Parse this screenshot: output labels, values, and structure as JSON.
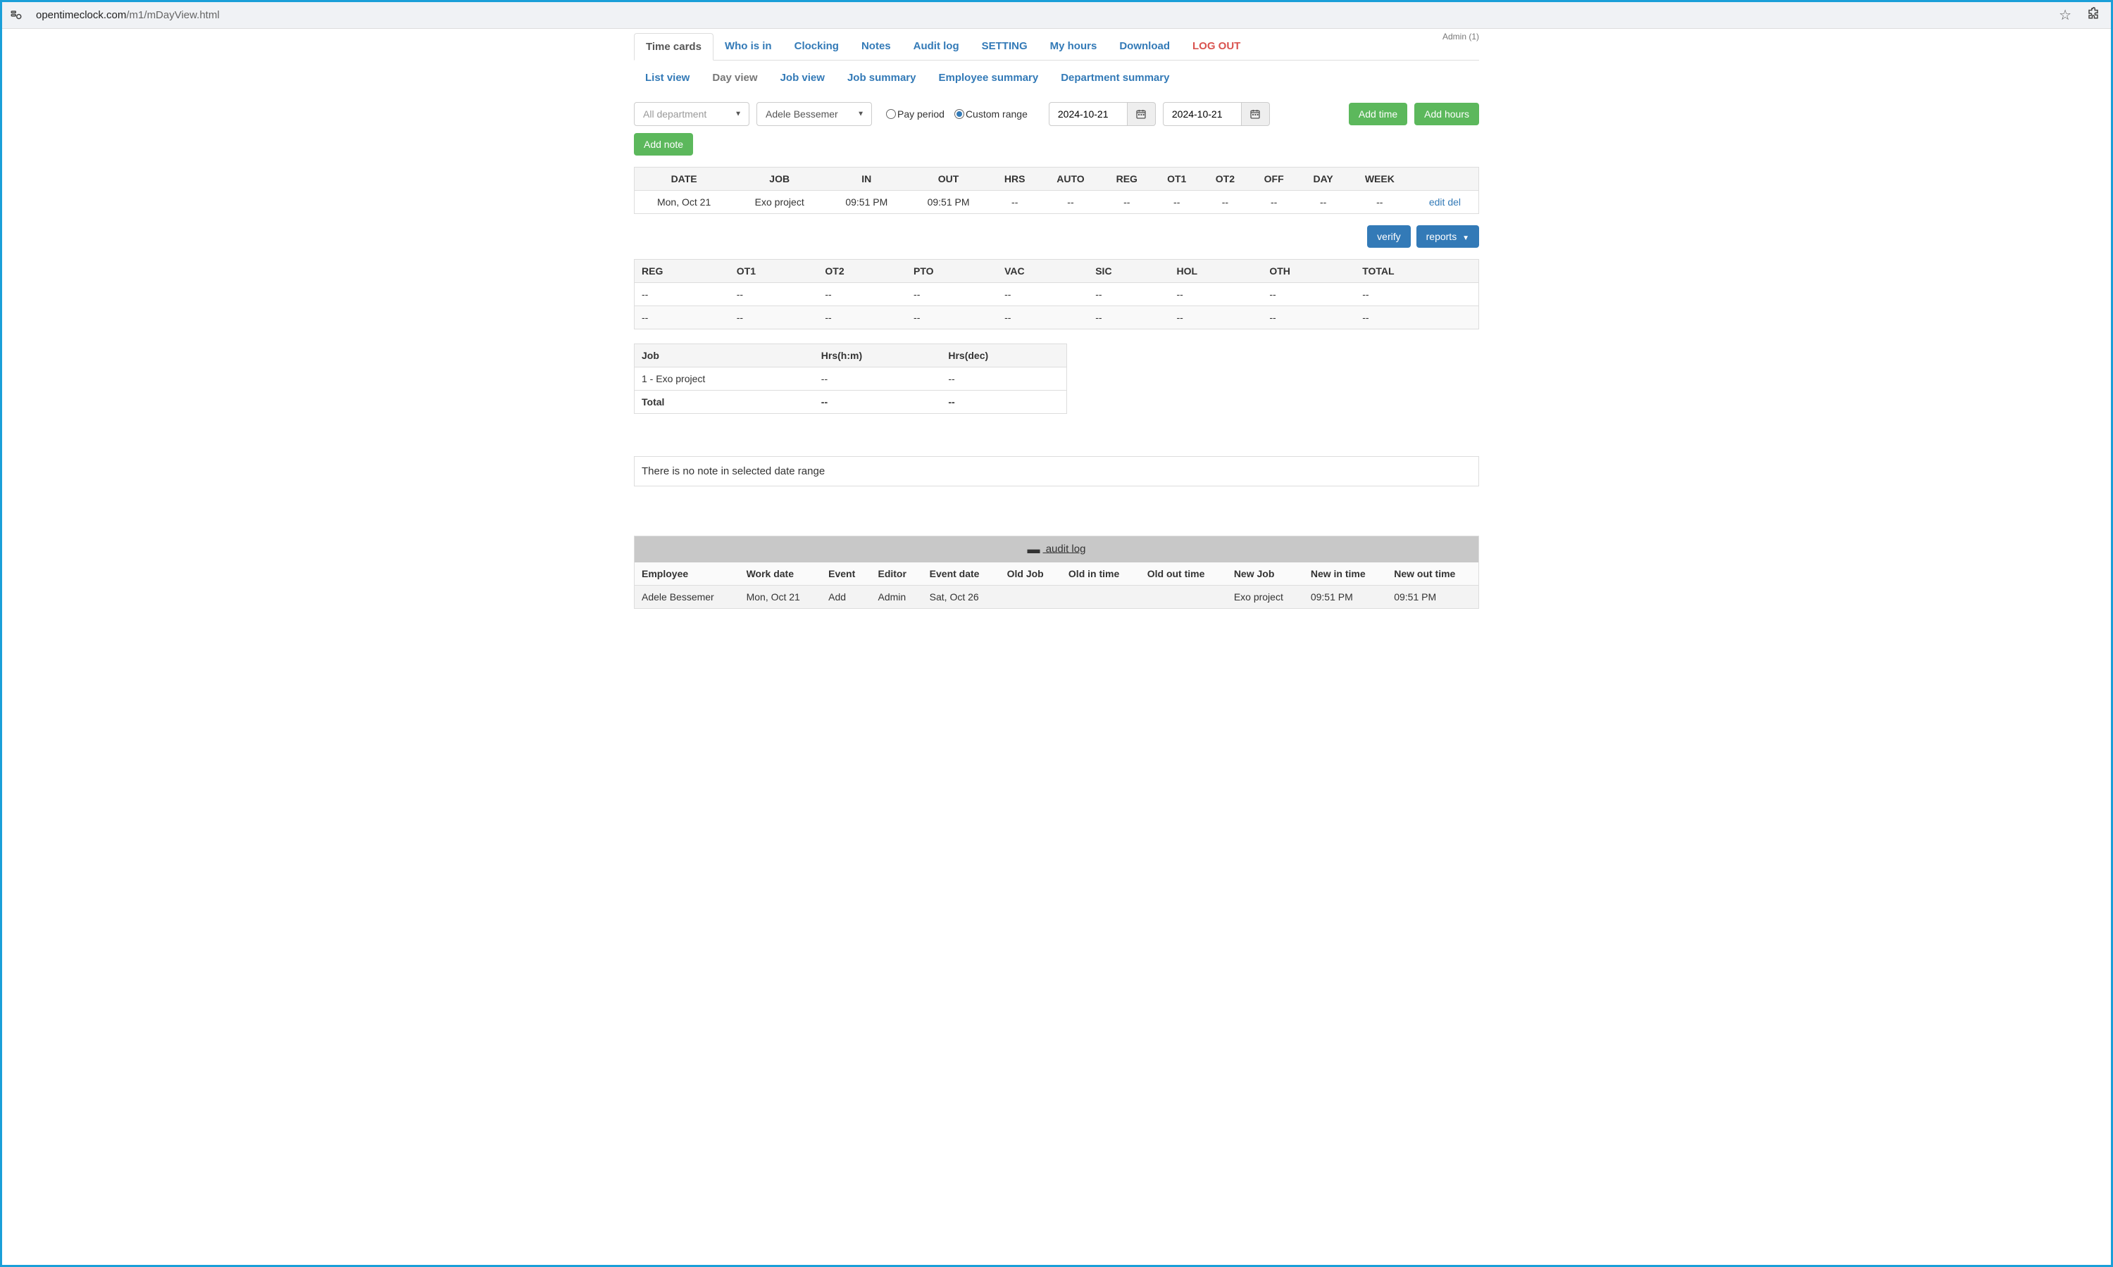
{
  "browser": {
    "url_host": "opentimeclock.com",
    "url_path": "/m1/mDayView.html"
  },
  "header": {
    "admin_label": "Admin (1)"
  },
  "nav": {
    "items": [
      {
        "label": "Time cards",
        "type": "active"
      },
      {
        "label": "Who is in"
      },
      {
        "label": "Clocking"
      },
      {
        "label": "Notes"
      },
      {
        "label": "Audit log"
      },
      {
        "label": "SETTING"
      },
      {
        "label": "My hours"
      },
      {
        "label": "Download"
      },
      {
        "label": "LOG OUT",
        "type": "logout"
      }
    ]
  },
  "subnav": {
    "items": [
      {
        "label": "List view"
      },
      {
        "label": "Day view",
        "active": true
      },
      {
        "label": "Job view"
      },
      {
        "label": "Job summary"
      },
      {
        "label": "Employee summary"
      },
      {
        "label": "Department summary"
      }
    ]
  },
  "filters": {
    "department_placeholder": "All department",
    "employee_selected": "Adele Bessemer",
    "pay_period_label": "Pay period",
    "custom_range_label": "Custom range",
    "date_start": "2024-10-21",
    "date_end": "2024-10-21"
  },
  "toolbar_buttons": {
    "add_time": "Add time",
    "add_hours": "Add hours",
    "add_note": "Add note"
  },
  "timelog": {
    "headers": [
      "DATE",
      "JOB",
      "IN",
      "OUT",
      "HRS",
      "AUTO",
      "REG",
      "OT1",
      "OT2",
      "OFF",
      "DAY",
      "WEEK",
      ""
    ],
    "row": {
      "date": "Mon, Oct 21",
      "job": "Exo project",
      "in": "09:51 PM",
      "out": "09:51 PM",
      "hrs": "--",
      "auto": "--",
      "reg": "--",
      "ot1": "--",
      "ot2": "--",
      "off": "--",
      "day": "--",
      "week": "--",
      "edit": "edit",
      "del": "del"
    }
  },
  "actions": {
    "verify": "verify",
    "reports": "reports"
  },
  "totals": {
    "headers": [
      "REG",
      "OT1",
      "OT2",
      "PTO",
      "VAC",
      "SIC",
      "HOL",
      "OTH",
      "TOTAL"
    ],
    "dash": "--"
  },
  "jobsummary": {
    "headers": [
      "Job",
      "Hrs(h:m)",
      "Hrs(dec)"
    ],
    "row_label": "1 - Exo project",
    "dash": "--",
    "total_label": "Total"
  },
  "note_message": "There is no note in selected date range",
  "audit": {
    "title": " audit log",
    "headers": [
      "Employee",
      "Work date",
      "Event",
      "Editor",
      "Event date",
      "Old Job",
      "Old in time",
      "Old out time",
      "New Job",
      "New in time",
      "New out time"
    ],
    "row": {
      "employee": "Adele Bessemer",
      "work_date": "Mon, Oct 21",
      "event": "Add",
      "editor": "Admin",
      "event_date": "Sat, Oct 26",
      "old_job": "",
      "old_in": "",
      "old_out": "",
      "new_job": "Exo project",
      "new_in": "09:51 PM",
      "new_out": "09:51 PM"
    }
  }
}
